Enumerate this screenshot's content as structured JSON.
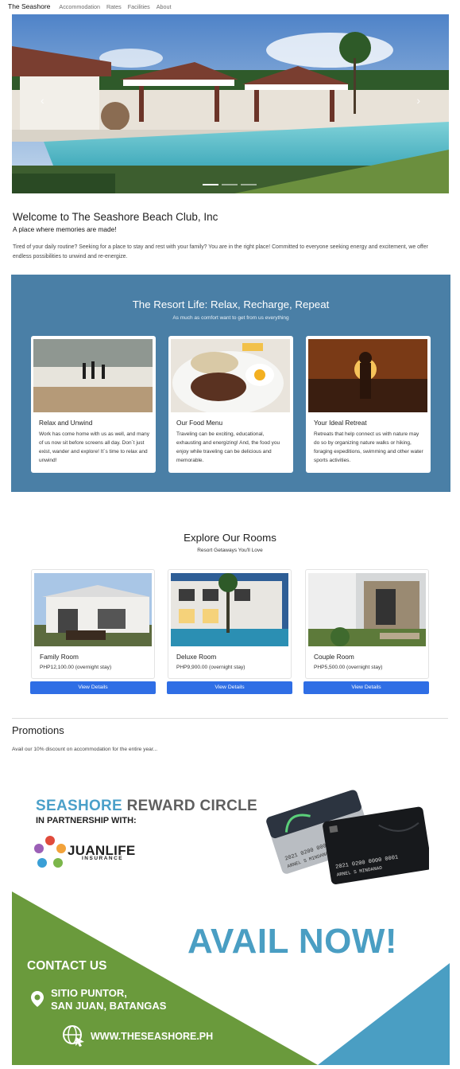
{
  "nav": {
    "brand": "The Seashore",
    "links": [
      "Accommodation",
      "Rates",
      "Facilities",
      "About"
    ]
  },
  "hero": {
    "prev_icon": "chevron-left-icon",
    "next_icon": "chevron-right-icon",
    "slide_count": 3,
    "active_slide": 1
  },
  "welcome": {
    "title": "Welcome to The Seashore Beach Club, Inc",
    "subtitle": "A place where memories are made!",
    "body": "Tired of your daily routine? Seeking for a place to stay and rest with your family? You are in the right place! Committed to everyone seeking energy and excitement, we offer endless possibilities to unwind and re-energize."
  },
  "resort": {
    "title": "The Resort Life: Relax, Recharge, Repeat",
    "subtitle": "As much as comfort want to get from us everything",
    "cards": [
      {
        "title": "Relax and Unwind",
        "text": "Work has come home with us as well, and many of us now sit before screens all day. Don´t just exist, wander and explore! It´s time to relax and unwind!"
      },
      {
        "title": "Our Food Menu",
        "text": "Traveling can be exciting, educational, exhausting and energizing! And, the food you enjoy while traveling can be delicious and memorable."
      },
      {
        "title": "Your Ideal Retreat",
        "text": "Retreats that help connect us with nature may do so by organizing nature walks or hiking, foraging expeditions, swimming and other water sports activities."
      }
    ],
    "bg_color": "#4a7fa6"
  },
  "rooms": {
    "title": "Explore Our Rooms",
    "subtitle": "Resort Getaways You'll Love",
    "items": [
      {
        "name": "Family Room",
        "price": "PHP12,100.00 (overnight stay)",
        "button": "View Details"
      },
      {
        "name": "Deluxe Room",
        "price": "PHP9,900.00 (overnight stay)",
        "button": "View Details"
      },
      {
        "name": "Couple Room",
        "price": "PHP5,500.00 (overnight stay)",
        "button": "View Details"
      }
    ],
    "button_color": "#2f6ee5"
  },
  "promotions": {
    "title": "Promotions",
    "text": "Avail our 10% discount on accommodation for the entire year...",
    "banner": {
      "title_a": "SEASHORE",
      "title_b": "REWARD CIRCLE",
      "partner_line": "IN PARTNERSHIP WITH:",
      "partner_name": "JUANLIFE",
      "partner_sub": "INSURANCE",
      "cta": "AVAIL NOW!",
      "contact": "CONTACT US",
      "address_line1": "SITIO PUNTOR,",
      "address_line2": "SAN JUAN, BATANGAS",
      "website": "WWW.THESEASHORE.PH",
      "card_number": "2021 0200 0000 0001",
      "card_holder": "ARNEL S MINDANAO",
      "green": "#6a9a3c",
      "blue": "#4a9ec3"
    }
  }
}
